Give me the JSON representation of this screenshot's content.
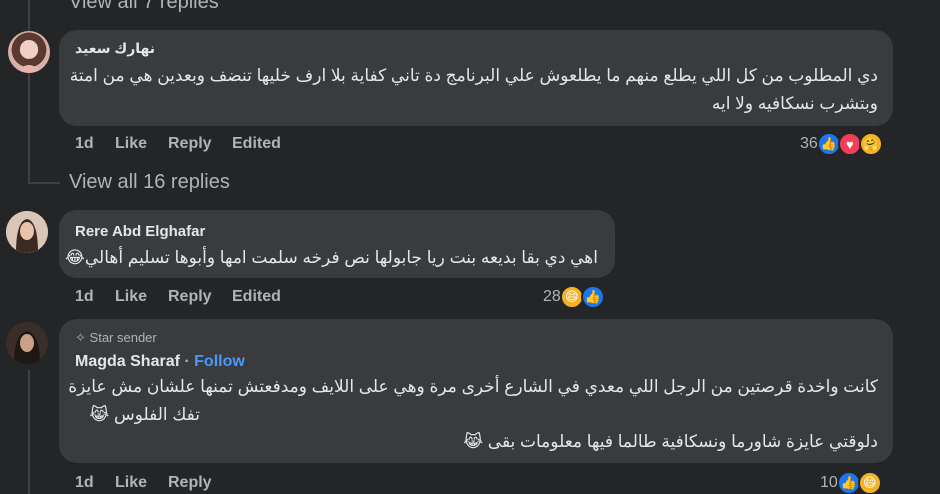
{
  "top_view_all": "View all 7 replies",
  "comments": [
    {
      "author": "نهارك سعيد",
      "lines": [
        "دي المطلوب من كل اللي يطلع منهم ما يطلعوش علي البرنامج دة تاني كفاية بلا ارف خليها تنضف وبعدين هي من امتة",
        "وبتشرب نسكافيه ولا ايه"
      ],
      "time": "1d",
      "like": "Like",
      "reply": "Reply",
      "edited": "Edited",
      "reactions_count": "36",
      "reaction_icons": [
        "like-icon",
        "love-icon",
        "care-icon"
      ]
    },
    {
      "author": "Rere Abd Elghafar",
      "lines": [
        "اهي دي بقا بديعه بنت ريا جابولها نص فرخه سلمت امها وأبوها تسليم أهالي😂"
      ],
      "time": "1d",
      "like": "Like",
      "reply": "Reply",
      "edited": "Edited",
      "reactions_count": "28",
      "reaction_icons": [
        "haha-icon",
        "like-icon"
      ]
    },
    {
      "badge": "Star sender",
      "author": "Magda Sharaf",
      "separator": "·",
      "follow": "Follow",
      "lines": [
        "كانت واخدة قرصتين من الرجل اللي معدي في الشارع أخرى مرة وهي على اللايف ومدفعتش تمنها علشان مش عايزة",
        "تفك الفلوس 😹",
        "دلوقتي عايزة شاورما ونسكافية طالما فيها معلومات بقى 😹"
      ],
      "time": "1d",
      "like": "Like",
      "reply": "Reply",
      "reactions_count": "10",
      "reaction_icons": [
        "like-icon",
        "haha-icon"
      ]
    }
  ],
  "mid_view_all": "View all 16 replies",
  "colors": {
    "background": "#242526",
    "bubble": "#3a3b3c",
    "text": "#e4e6eb",
    "muted": "#b0b3b8",
    "link": "#4599ff"
  }
}
